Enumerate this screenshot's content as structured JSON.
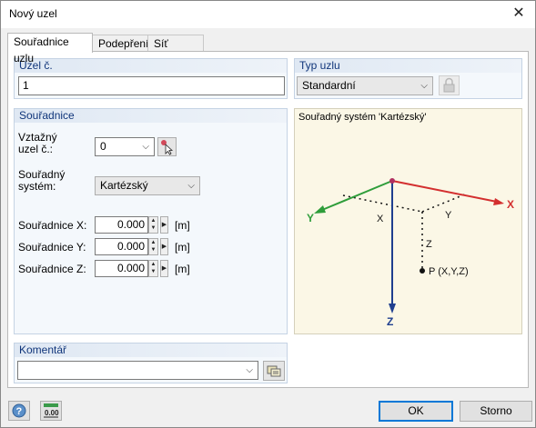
{
  "window": {
    "title": "Nový uzel"
  },
  "tabs": [
    "Souřadnice uzlu",
    "Podepření",
    "Síť prvků"
  ],
  "node": {
    "header": "Uzel č.",
    "value": "1"
  },
  "node_type": {
    "header": "Typ uzlu",
    "value": "Standardní"
  },
  "coordinates": {
    "header": "Souřadnice",
    "ref_node_label_1": "Vztažný",
    "ref_node_label_2": "uzel č.:",
    "ref_node_value": "0",
    "system_label_1": "Souřadný",
    "system_label_2": "systém:",
    "system_value": "Kartézský",
    "rows": [
      {
        "label": "Souřadnice X:",
        "value": "0.000",
        "unit": "[m]"
      },
      {
        "label": "Souřadnice Y:",
        "value": "0.000",
        "unit": "[m]"
      },
      {
        "label": "Souřadnice Z:",
        "value": "0.000",
        "unit": "[m]"
      }
    ]
  },
  "diagram": {
    "title": "Souřadný systém 'Kartézský'",
    "axis_x": "X",
    "axis_y": "Y",
    "axis_z": "Z",
    "dim_x": "X",
    "dim_y": "Y",
    "dim_z": "Z",
    "point": "P (X,Y,Z)",
    "colors": {
      "x": "#d32f2f",
      "y": "#2e9d3a",
      "z": "#1f3f8f",
      "origin": "#b03060"
    }
  },
  "comment": {
    "header": "Komentář",
    "value": ""
  },
  "footer": {
    "ok": "OK",
    "cancel": "Storno",
    "units_icon_text": "0.00"
  },
  "icons": {
    "close": "close-icon",
    "pick": "pick-node-icon",
    "lock": "lock-icon",
    "comment_lib": "comment-library-icon",
    "help": "help-icon",
    "units": "units-icon"
  }
}
